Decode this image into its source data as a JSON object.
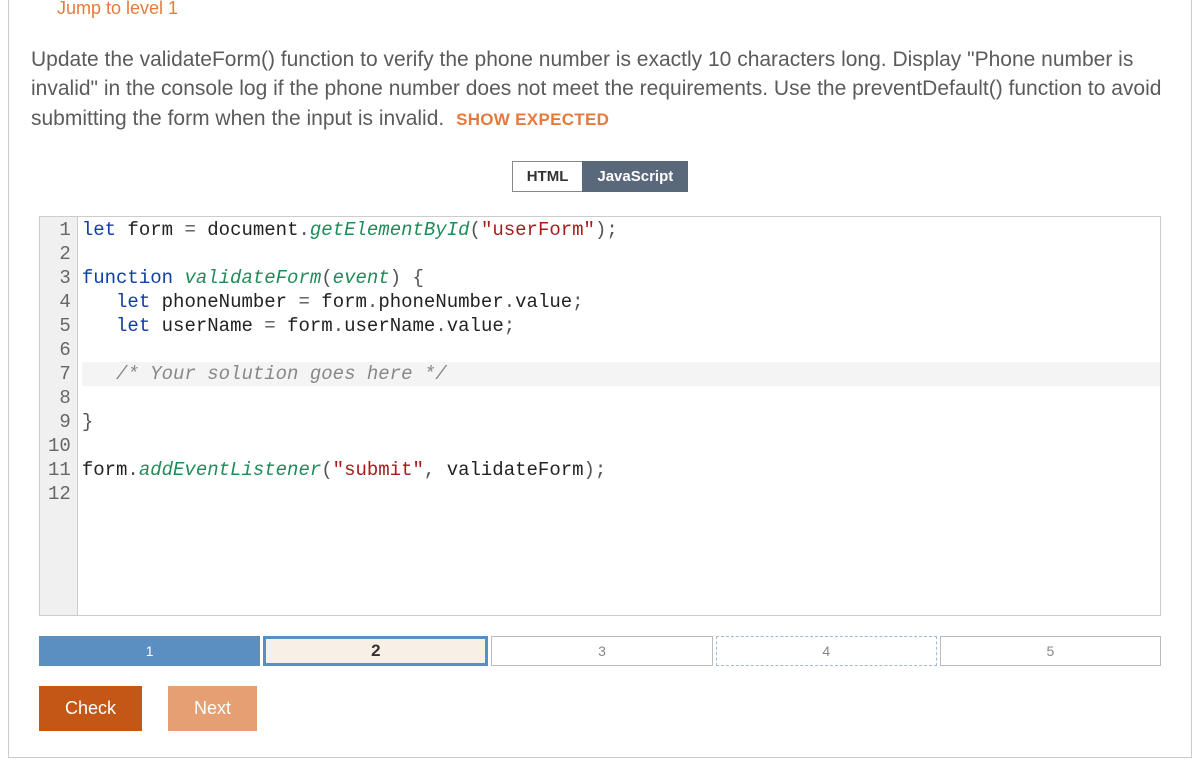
{
  "jump_link": "Jump to level 1",
  "instructions": "Update the validateForm() function to verify the phone number is exactly 10 characters long. Display \"Phone number is invalid\" in the console log if the phone number does not meet the requirements. Use the preventDefault() function to avoid submitting the form when the input is invalid.",
  "show_expected": "SHOW EXPECTED",
  "tabs": {
    "html": "HTML",
    "javascript": "JavaScript",
    "active": "javascript"
  },
  "code": {
    "line_numbers": [
      "1",
      "2",
      "3",
      "4",
      "5",
      "6",
      "7",
      "8",
      "9",
      "10",
      "11",
      "12"
    ],
    "lines": [
      [
        {
          "t": "let",
          "c": "kw"
        },
        {
          "t": " form "
        },
        {
          "t": "=",
          "c": "punct"
        },
        {
          "t": " document"
        },
        {
          "t": ".",
          "c": "punct"
        },
        {
          "t": "getElementById",
          "c": "fn"
        },
        {
          "t": "(",
          "c": "punct"
        },
        {
          "t": "\"userForm\"",
          "c": "str"
        },
        {
          "t": ");",
          "c": "punct"
        }
      ],
      [],
      [
        {
          "t": "function",
          "c": "kw"
        },
        {
          "t": " "
        },
        {
          "t": "validateForm",
          "c": "fn"
        },
        {
          "t": "(",
          "c": "punct"
        },
        {
          "t": "event",
          "c": "fn"
        },
        {
          "t": ") {",
          "c": "punct"
        }
      ],
      [
        {
          "t": "   "
        },
        {
          "t": "let",
          "c": "kw"
        },
        {
          "t": " phoneNumber "
        },
        {
          "t": "=",
          "c": "punct"
        },
        {
          "t": " form"
        },
        {
          "t": ".",
          "c": "punct"
        },
        {
          "t": "phoneNumber"
        },
        {
          "t": ".",
          "c": "punct"
        },
        {
          "t": "value"
        },
        {
          "t": ";",
          "c": "punct"
        }
      ],
      [
        {
          "t": "   "
        },
        {
          "t": "let",
          "c": "kw"
        },
        {
          "t": " userName "
        },
        {
          "t": "=",
          "c": "punct"
        },
        {
          "t": " form"
        },
        {
          "t": ".",
          "c": "punct"
        },
        {
          "t": "userName"
        },
        {
          "t": ".",
          "c": "punct"
        },
        {
          "t": "value"
        },
        {
          "t": ";",
          "c": "punct"
        }
      ],
      [],
      [
        {
          "t": "   "
        },
        {
          "t": "/* Your solution goes here */",
          "c": "comment"
        }
      ],
      [],
      [
        {
          "t": "}",
          "c": "punct"
        }
      ],
      [],
      [
        {
          "t": "form"
        },
        {
          "t": ".",
          "c": "punct"
        },
        {
          "t": "addEventListener",
          "c": "fn"
        },
        {
          "t": "(",
          "c": "punct"
        },
        {
          "t": "\"submit\"",
          "c": "str"
        },
        {
          "t": ", ",
          "c": "punct"
        },
        {
          "t": "validateForm"
        },
        {
          "t": ");",
          "c": "punct"
        }
      ],
      []
    ],
    "highlight_line_index": 6
  },
  "steps": {
    "items": [
      "1",
      "2",
      "3",
      "4",
      "5"
    ],
    "done_index": 0,
    "current_index": 1
  },
  "buttons": {
    "check": "Check",
    "next": "Next"
  }
}
